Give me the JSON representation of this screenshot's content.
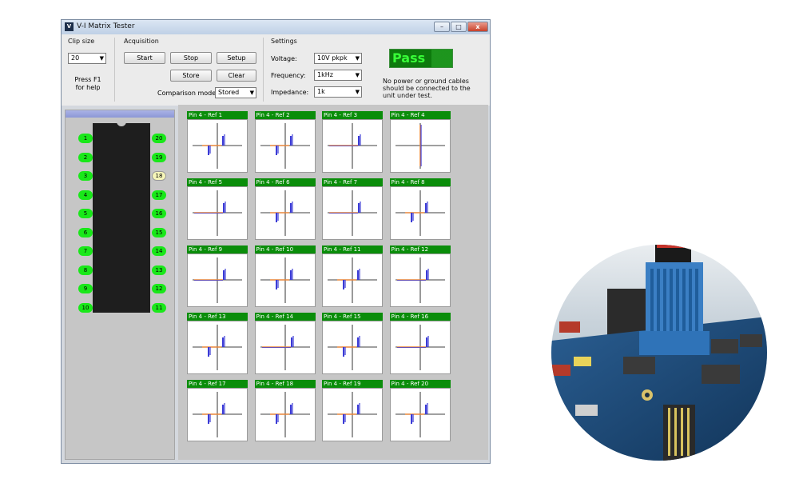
{
  "window": {
    "title": "V-I Matrix Tester",
    "controls": {
      "minimize": "–",
      "maximize": "□",
      "close": "x"
    }
  },
  "clip_size": {
    "label": "Clip size",
    "value": "20"
  },
  "help_text": [
    "Press F1",
    "for help"
  ],
  "acquisition": {
    "label": "Acquisition",
    "start": "Start",
    "stop": "Stop",
    "setup": "Setup",
    "store": "Store",
    "clear": "Clear",
    "comparison_label": "Comparison mode",
    "comparison_value": "Stored"
  },
  "settings": {
    "label": "Settings",
    "voltage_label": "Voltage:",
    "voltage_value": "10V pkpk",
    "frequency_label": "Frequency:",
    "frequency_value": "1kHz",
    "impedance_label": "Impedance:",
    "impedance_value": "1k"
  },
  "result": "Pass",
  "note": "No power or ground cables should be connected to the unit under test.",
  "ic": {
    "left_pins": [
      "1",
      "2",
      "3",
      "4",
      "5",
      "6",
      "7",
      "8",
      "9",
      "10"
    ],
    "right_pins": [
      "20",
      "19",
      "18",
      "17",
      "16",
      "15",
      "14",
      "13",
      "12",
      "11"
    ],
    "selected_pin": "18"
  },
  "graphs": [
    {
      "title": "Pin 4 - Ref 1",
      "trace": "step"
    },
    {
      "title": "Pin 4 - Ref 2",
      "trace": "step"
    },
    {
      "title": "Pin 4 - Ref 3",
      "trace": "flat"
    },
    {
      "title": "Pin 4 - Ref 4",
      "trace": "vertical"
    },
    {
      "title": "Pin 4 - Ref 5",
      "trace": "flat"
    },
    {
      "title": "Pin 4 - Ref 6",
      "trace": "step"
    },
    {
      "title": "Pin 4 - Ref 7",
      "trace": "flat"
    },
    {
      "title": "Pin 4 - Ref 8",
      "trace": "step"
    },
    {
      "title": "Pin 4 - Ref 9",
      "trace": "flat"
    },
    {
      "title": "Pin 4 - Ref 10",
      "trace": "step"
    },
    {
      "title": "Pin 4 - Ref 11",
      "trace": "step"
    },
    {
      "title": "Pin 4 - Ref 12",
      "trace": "flat"
    },
    {
      "title": "Pin 4 - Ref 13",
      "trace": "step"
    },
    {
      "title": "Pin 4 - Ref 14",
      "trace": "flat"
    },
    {
      "title": "Pin 4 - Ref 15",
      "trace": "step"
    },
    {
      "title": "Pin 4 - Ref 16",
      "trace": "flat"
    },
    {
      "title": "Pin 4 - Ref 17",
      "trace": "step"
    },
    {
      "title": "Pin 4 - Ref 18",
      "trace": "step"
    },
    {
      "title": "Pin 4 - Ref 19",
      "trace": "step"
    },
    {
      "title": "Pin 4 - Ref 20",
      "trace": "step"
    }
  ],
  "colors": {
    "pass_bg": "#0d7a0d",
    "pass_text": "#38ff38",
    "pin_green": "#19e819",
    "trace_blue": "#3b3bd6",
    "trace_orange": "#e8863a"
  }
}
